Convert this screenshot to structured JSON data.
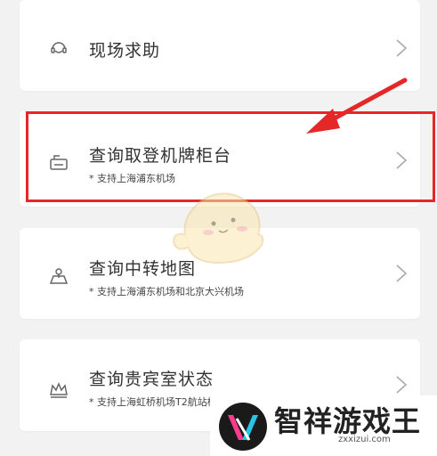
{
  "cards": [
    {
      "icon": "help-headset-icon",
      "title": "现场求助"
    },
    {
      "icon": "boarding-counter-icon",
      "title": "查询取登机牌柜台",
      "subtitle": "* 支持上海浦东机场"
    },
    {
      "icon": "transfer-map-icon",
      "title": "查询中转地图",
      "subtitle": "* 支持上海浦东机场和北京大兴机场"
    },
    {
      "icon": "vip-crown-icon",
      "title": "查询贵宾室状态",
      "subtitle": "* 支持上海虹桥机场T2航站楼"
    }
  ],
  "annotation": {
    "highlight_color": "#e52727",
    "target": "查询取登机牌柜台"
  },
  "watermark": {
    "name": "智祥游戏王",
    "url": "zxxizui.com"
  },
  "colors": {
    "background": "#f2f2f2",
    "card": "#ffffff",
    "title": "#333333",
    "chevron": "#aaaaaa"
  }
}
